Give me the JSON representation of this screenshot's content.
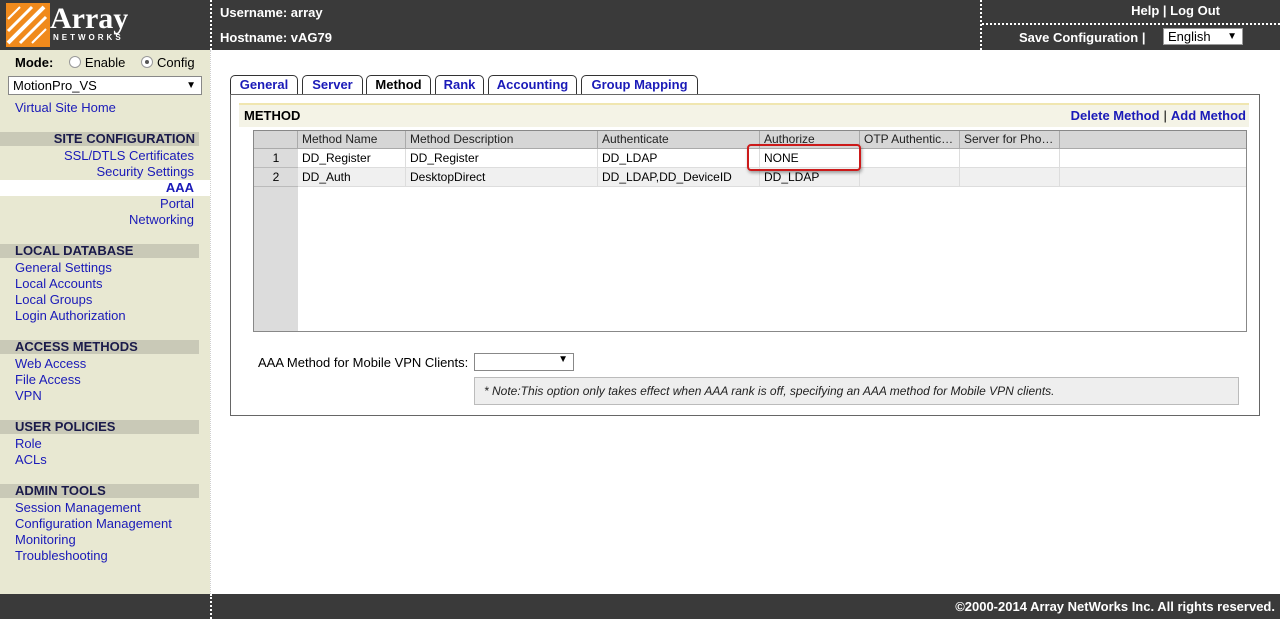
{
  "header": {
    "logo_text": "Array",
    "logo_sub": "NETWORKS",
    "username_label": "Username: array",
    "hostname_label": "Hostname: vAG79",
    "help": "Help",
    "link_sep": "|",
    "logout": "Log Out",
    "save_config": "Save Configuration",
    "language": "English",
    "colors": {
      "bar": "#3a3a3a",
      "logo_accent": "#f08a1c"
    }
  },
  "sidebar": {
    "mode_label": "Mode:",
    "mode_enable": "Enable",
    "mode_config": "Config",
    "virtual_site": "MotionPro_VS",
    "virtual_site_home": "Virtual Site Home",
    "site_configuration": {
      "heading": "SITE CONFIGURATION",
      "items": [
        "SSL/DTLS Certificates",
        "Security Settings",
        "AAA",
        "Portal",
        "Networking"
      ]
    },
    "local_database": {
      "heading": "LOCAL DATABASE",
      "items": [
        "General Settings",
        "Local Accounts",
        "Local Groups",
        "Login Authorization"
      ]
    },
    "access_methods": {
      "heading": "ACCESS METHODS",
      "items": [
        "Web Access",
        "File Access",
        "VPN"
      ]
    },
    "user_policies": {
      "heading": "USER POLICIES",
      "items": [
        "Role",
        "ACLs"
      ]
    },
    "admin_tools": {
      "heading": "ADMIN TOOLS",
      "items": [
        "Session Management",
        "Configuration Management",
        "Monitoring",
        "Troubleshooting"
      ]
    }
  },
  "tabs": [
    "General",
    "Server",
    "Method",
    "Rank",
    "Accounting",
    "Group Mapping"
  ],
  "active_tab": "Method",
  "panel": {
    "title": "METHOD",
    "delete_method": "Delete Method",
    "add_method": "Add Method",
    "sep": "|",
    "columns": [
      "Method Name",
      "Method Description",
      "Authenticate",
      "Authorize",
      "OTP Authentic…",
      "Server for Pho…"
    ],
    "rows": [
      {
        "num": "1",
        "cells": [
          "DD_Register",
          "DD_Register",
          "DD_LDAP",
          "NONE",
          "",
          ""
        ]
      },
      {
        "num": "2",
        "cells": [
          "DD_Auth",
          "DesktopDirect",
          "DD_LDAP,DD_DeviceID",
          "DD_LDAP",
          "",
          ""
        ]
      }
    ],
    "mobile_label": "AAA Method for Mobile VPN Clients:",
    "mobile_value": "",
    "note": "* Note:This option only takes effect when AAA rank is off, specifying an AAA method for Mobile VPN clients."
  },
  "footer": {
    "copyright": "©2000-2014 Array NetWorks Inc. All rights reserved."
  }
}
